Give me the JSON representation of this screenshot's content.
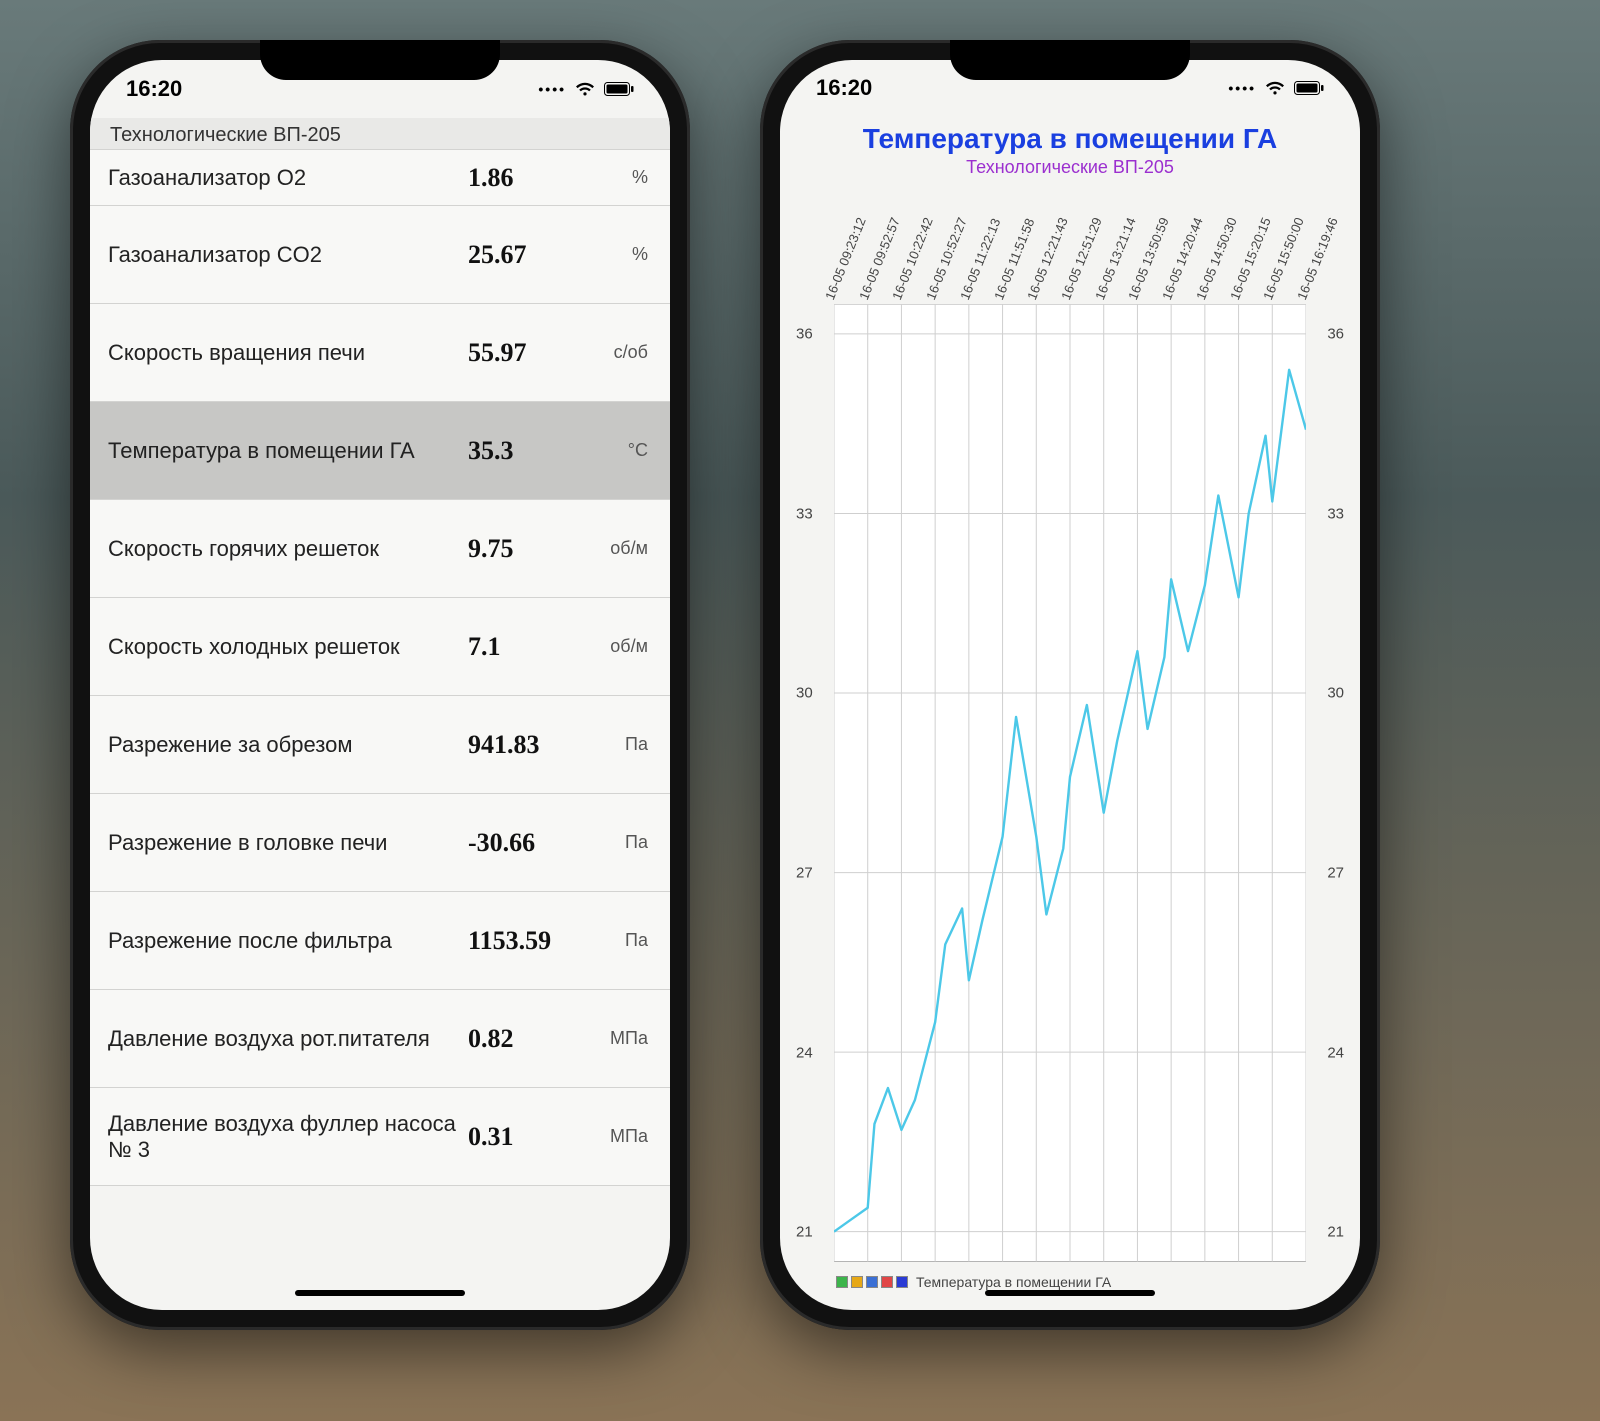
{
  "statusbar": {
    "time": "16:20"
  },
  "left": {
    "section_title": "Технологические ВП-205",
    "rows": [
      {
        "label": "Газоанализатор O2",
        "value": "1.86",
        "unit": "%"
      },
      {
        "label": "Газоанализатор CO2",
        "value": "25.67",
        "unit": "%"
      },
      {
        "label": "Скорость вращения печи",
        "value": "55.97",
        "unit": "с/об"
      },
      {
        "label": "Температура в помещении ГА",
        "value": "35.3",
        "unit": "°C",
        "selected": true
      },
      {
        "label": "Скорость горячих решеток",
        "value": "9.75",
        "unit": "об/м"
      },
      {
        "label": "Скорость холодных решеток",
        "value": "7.1",
        "unit": "об/м"
      },
      {
        "label": "Разрежение за обрезом",
        "value": "941.83",
        "unit": "Па"
      },
      {
        "label": "Разрежение в головке печи",
        "value": "-30.66",
        "unit": "Па"
      },
      {
        "label": "Разрежение после фильтра",
        "value": "1153.59",
        "unit": "Па"
      },
      {
        "label": "Давление воздуха рот.питателя",
        "value": "0.82",
        "unit": "МПа"
      },
      {
        "label": "Давление воздуха фуллер насоса № 3",
        "value": "0.31",
        "unit": "МПа"
      }
    ]
  },
  "right": {
    "title": "Температура в помещении ГА",
    "subtitle": "Технологические ВП-205",
    "legend_label": "Температура в помещении ГА",
    "legend_swatches": [
      "#3cb44b",
      "#e6a817",
      "#3b6fd4",
      "#e04646",
      "#2a3bd4"
    ]
  },
  "chart_data": {
    "type": "line",
    "title": "Температура в помещении ГА",
    "subtitle": "Технологические ВП-205",
    "xlabel": "",
    "ylabel": "",
    "ylim": [
      20.5,
      36.5
    ],
    "x_ticks": [
      "16-05 09:23:12",
      "16-05 09:52:57",
      "16-05 10:22:42",
      "16-05 10:52:27",
      "16-05 11:22:13",
      "16-05 11:51:58",
      "16-05 12:21:43",
      "16-05 12:51:29",
      "16-05 13:21:14",
      "16-05 13:50:59",
      "16-05 14:20:44",
      "16-05 14:50:30",
      "16-05 15:20:15",
      "16-05 15:50:00",
      "16-05 16:19:46"
    ],
    "y_ticks": [
      21,
      24,
      27,
      30,
      33,
      36
    ],
    "series": [
      {
        "name": "Температура в помещении ГА",
        "color": "#4cc8e8",
        "x": [
          0,
          0.5,
          1,
          1.2,
          1.6,
          2,
          2.4,
          3,
          3.3,
          3.8,
          4,
          4.4,
          5,
          5.4,
          6,
          6.3,
          6.8,
          7,
          7.5,
          8,
          8.4,
          9,
          9.3,
          9.8,
          10,
          10.5,
          11,
          11.4,
          12,
          12.3,
          12.8,
          13,
          13.5,
          14
        ],
        "y": [
          21.0,
          21.2,
          21.4,
          22.8,
          23.4,
          22.7,
          23.2,
          24.5,
          25.8,
          26.4,
          25.2,
          26.2,
          27.6,
          29.6,
          27.6,
          26.3,
          27.4,
          28.6,
          29.8,
          28.0,
          29.2,
          30.7,
          29.4,
          30.6,
          31.9,
          30.7,
          31.8,
          33.3,
          31.6,
          33.0,
          34.3,
          33.2,
          35.4,
          34.4
        ]
      }
    ]
  }
}
